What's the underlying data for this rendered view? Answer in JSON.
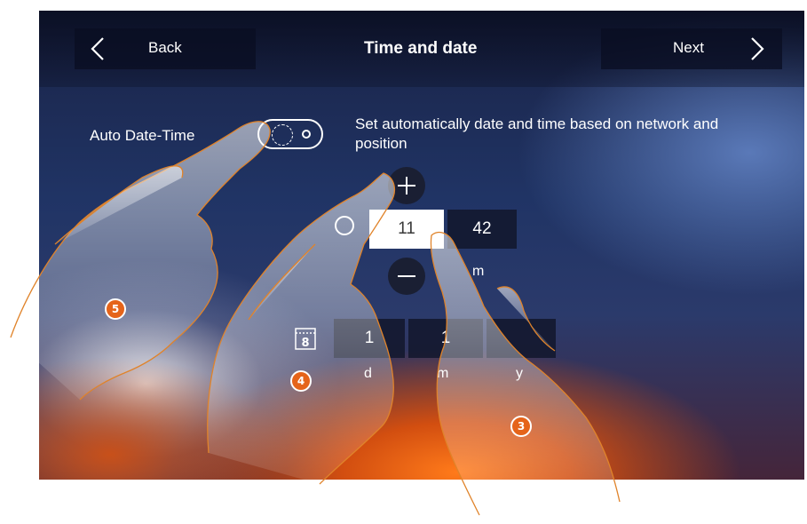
{
  "header": {
    "back_label": "Back",
    "title": "Time and date",
    "next_label": "Next"
  },
  "auto": {
    "label": "Auto Date-Time",
    "description": "Set automatically date and time based on network and position",
    "toggle_on": false
  },
  "time": {
    "hours": "11",
    "minutes": "42",
    "unit_label": "m"
  },
  "date": {
    "day": "1",
    "month": "1",
    "year": "",
    "day_label": "d",
    "month_label": "m",
    "year_label": "y",
    "calendar_digit": "8"
  },
  "badges": {
    "three": "3",
    "four": "4",
    "five": "5"
  },
  "colors": {
    "accent": "#e5641a",
    "screen_top": "#1a2346",
    "glow": "#ff7a1a"
  },
  "icons": [
    "chevron-left-icon",
    "chevron-right-icon",
    "plus-icon",
    "minus-icon",
    "clock-icon",
    "calendar-icon"
  ]
}
